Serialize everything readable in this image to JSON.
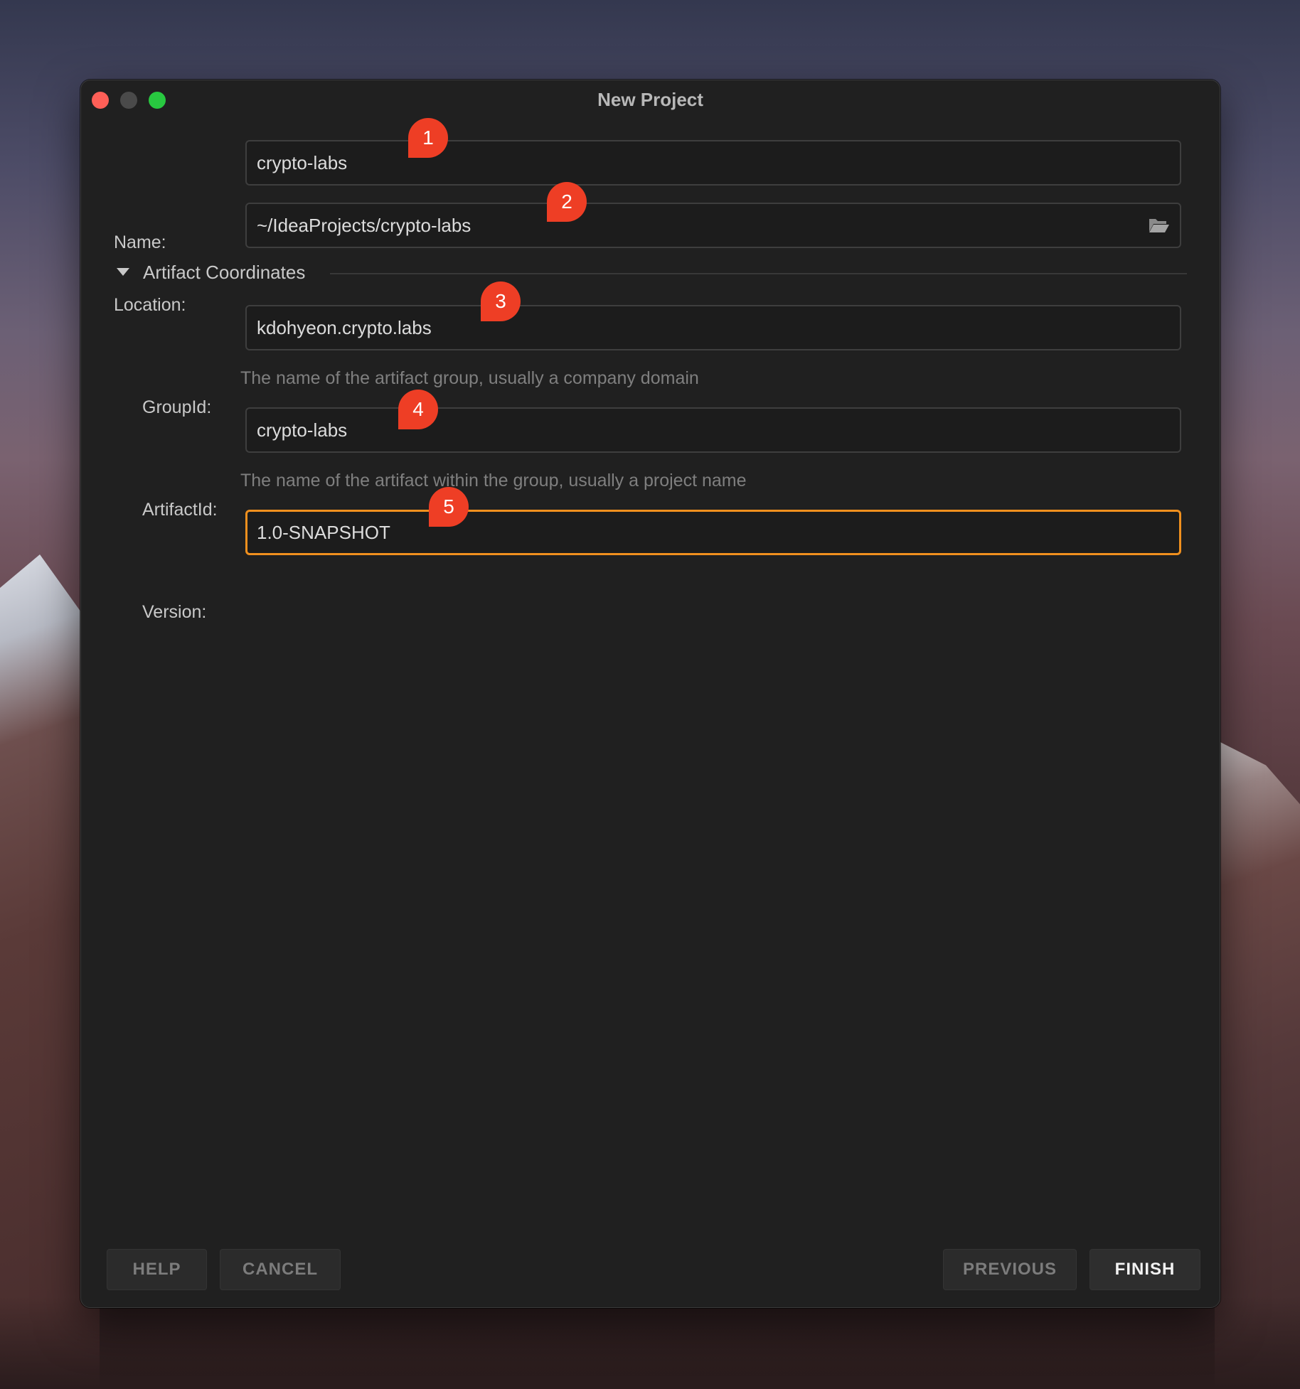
{
  "window": {
    "title": "New Project"
  },
  "form": {
    "name": {
      "label": "Name:",
      "value": "crypto-labs"
    },
    "location": {
      "label": "Location:",
      "value": "~/IdeaProjects/crypto-labs",
      "browse_icon": "folder-open-icon"
    },
    "section": {
      "label": "Artifact Coordinates",
      "expanded": true
    },
    "group_id": {
      "label": "GroupId:",
      "value": "kdohyeon.crypto.labs",
      "help": "The name of the artifact group, usually a company domain"
    },
    "artifact_id": {
      "label": "ArtifactId:",
      "value": "crypto-labs",
      "help": "The name of the artifact within the group, usually a project name"
    },
    "version": {
      "label": "Version:",
      "value": "1.0-SNAPSHOT",
      "focused": true
    }
  },
  "callouts": [
    "1",
    "2",
    "3",
    "4",
    "5"
  ],
  "buttons": {
    "help": "HELP",
    "cancel": "CANCEL",
    "previous": "PREVIOUS",
    "finish": "FINISH"
  },
  "colors": {
    "window_bg": "#202020",
    "field_bg": "#1c1c1c",
    "focus_border": "#f0901e",
    "callout": "#ee3e25",
    "traffic_close": "#fe5f57",
    "traffic_zoom": "#28c840"
  }
}
